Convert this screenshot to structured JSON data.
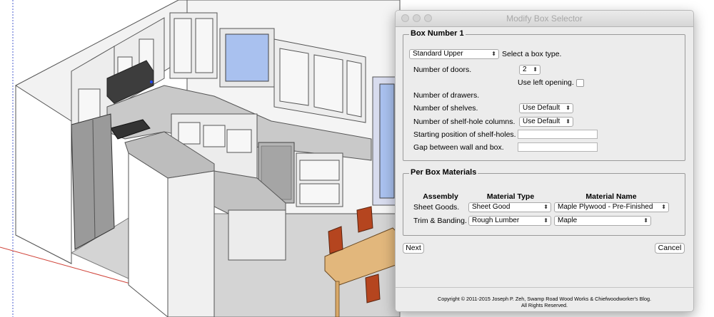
{
  "window": {
    "title": "Modify Box Selector"
  },
  "box_section": {
    "legend": "Box Number 1",
    "box_type": {
      "value": "Standard Upper",
      "label": "Select a box type."
    },
    "doors": {
      "label": "Number of doors.",
      "value": "2"
    },
    "left_opening": {
      "label": "Use left opening."
    },
    "drawers": {
      "label": "Number of drawers."
    },
    "shelves": {
      "label": "Number of shelves.",
      "value": "Use Default"
    },
    "shelf_hole_columns": {
      "label": "Number of shelf-hole columns.",
      "value": "Use Default"
    },
    "shelf_hole_start": {
      "label": "Starting position of shelf-holes.",
      "value": ""
    },
    "gap": {
      "label": "Gap between wall and box.",
      "value": ""
    }
  },
  "materials_section": {
    "legend": "Per Box Materials",
    "headers": {
      "assembly": "Assembly",
      "type": "Material Type",
      "name": "Material Name"
    },
    "rows": [
      {
        "assembly": "Sheet Goods.",
        "type": "Sheet Good",
        "name": "Maple Plywood - Pre-Finished"
      },
      {
        "assembly": "Trim & Banding.",
        "type": "Rough Lumber",
        "name": "Maple"
      }
    ]
  },
  "buttons": {
    "next": "Next",
    "cancel": "Cancel"
  },
  "footer": {
    "line1": "Copyright © 2011-2015 Joseph P. Zeh, Swamp Road Wood Works & Chiefwoodworker's Blog.",
    "line2": "All Rights Reserved."
  },
  "colors": {
    "window_pane": "#a9c1ef",
    "countertop": "#c9c9c9",
    "appliance": "#9a9a9a",
    "table_wood": "#e2b77c",
    "chair": "#b5451f"
  }
}
